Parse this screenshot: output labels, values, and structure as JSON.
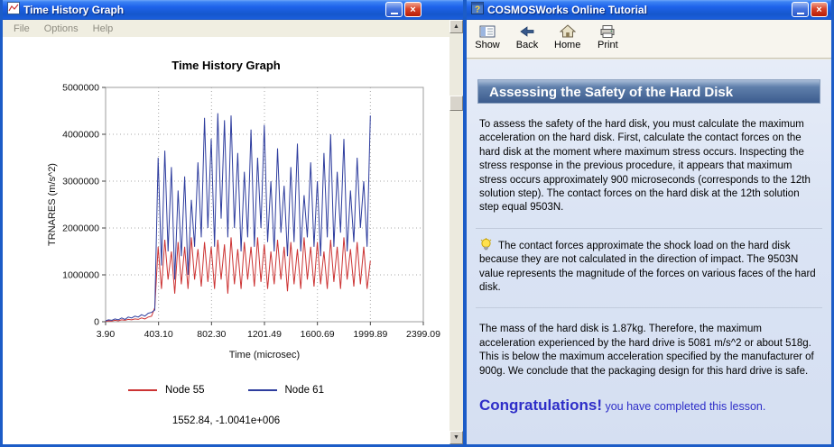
{
  "left_window": {
    "title": "Time History Graph",
    "menu": [
      "File",
      "Options",
      "Help"
    ],
    "chart_title": "Time History Graph",
    "status_readout": "1552.84, -1.0041e+006"
  },
  "chart_data": {
    "type": "line",
    "title": "Time History Graph",
    "xlabel": "Time (microsec)",
    "ylabel": "TRNARES (m/s^2)",
    "xlim": [
      3.9,
      2399.09
    ],
    "ylim": [
      0,
      5000000
    ],
    "x_tick_labels": [
      "3.90",
      "403.10",
      "802.30",
      "1201.49",
      "1600.69",
      "1999.89",
      "2399.09"
    ],
    "y_ticks": [
      0,
      1000000,
      2000000,
      3000000,
      4000000,
      5000000
    ],
    "grid": true,
    "legend_position": "bottom",
    "x": [
      3.9,
      25,
      50,
      75,
      100,
      125,
      150,
      175,
      200,
      225,
      250,
      275,
      300,
      325,
      350,
      375,
      400,
      425,
      450,
      475,
      500,
      525,
      550,
      575,
      600,
      625,
      650,
      675,
      700,
      725,
      750,
      775,
      800,
      825,
      850,
      875,
      900,
      925,
      950,
      975,
      1000,
      1025,
      1050,
      1075,
      1100,
      1125,
      1150,
      1175,
      1200,
      1225,
      1250,
      1275,
      1300,
      1325,
      1350,
      1375,
      1400,
      1425,
      1450,
      1475,
      1500,
      1525,
      1550,
      1575,
      1600,
      1625,
      1650,
      1675,
      1700,
      1725,
      1750,
      1775,
      1800,
      1825,
      1850,
      1875,
      1900,
      1925,
      1950,
      1975,
      2000
    ],
    "series": [
      {
        "name": "Node 55",
        "color": "#cc3333",
        "values": [
          10000.0,
          20000.0,
          15000.0,
          30000.0,
          20000.0,
          40000.0,
          30000.0,
          50000.0,
          40000.0,
          60000.0,
          50000.0,
          80000.0,
          60000.0,
          100000.0,
          120000.0,
          300000.0,
          1600000.0,
          700000.0,
          1750000.0,
          900000.0,
          1500000.0,
          600000.0,
          1700000.0,
          800000.0,
          1600000.0,
          700000.0,
          1800000.0,
          900000.0,
          1550000.0,
          750000.0,
          1700000.0,
          850000.0,
          1600000.0,
          700000.0,
          1750000.0,
          900000.0,
          1650000.0,
          600000.0,
          1800000.0,
          800000.0,
          1550000.0,
          700000.0,
          1700000.0,
          900000.0,
          1600000.0,
          750000.0,
          1800000.0,
          850000.0,
          1650000.0,
          700000.0,
          1500000.0,
          800000.0,
          1750000.0,
          900000.0,
          1600000.0,
          650000.0,
          1700000.0,
          800000.0,
          1550000.0,
          700000.0,
          1800000.0,
          900000.0,
          1600000.0,
          750000.0,
          1700000.0,
          800000.0,
          1500000.0,
          700000.0,
          1750000.0,
          850000.0,
          1600000.0,
          700000.0,
          1800000.0,
          900000.0,
          1550000.0,
          750000.0,
          1700000.0,
          800000.0,
          1600000.0,
          700000.0,
          1300000.0
        ]
      },
      {
        "name": "Node 61",
        "color": "#2e3d9e",
        "values": [
          20000.0,
          40000.0,
          30000.0,
          60000.0,
          40000.0,
          80000.0,
          50000.0,
          100000.0,
          80000.0,
          120000.0,
          100000.0,
          150000.0,
          120000.0,
          180000.0,
          200000.0,
          250000.0,
          3500000.0,
          1200000.0,
          3650000.0,
          1500000.0,
          3300000.0,
          900000.0,
          2800000.0,
          1400000.0,
          3100000.0,
          1000000.0,
          2600000.0,
          1600000.0,
          3400000.0,
          1800000.0,
          4350000.0,
          2000000.0,
          3900000.0,
          1600000.0,
          4450000.0,
          2200000.0,
          4300000.0,
          1800000.0,
          4400000.0,
          2000000.0,
          3600000.0,
          1500000.0,
          3200000.0,
          1800000.0,
          4100000.0,
          1600000.0,
          3500000.0,
          2000000.0,
          4200000.0,
          1700000.0,
          3000000.0,
          1500000.0,
          3700000.0,
          1900000.0,
          2900000.0,
          1400000.0,
          3300000.0,
          1700000.0,
          3800000.0,
          1500000.0,
          2700000.0,
          1800000.0,
          3400000.0,
          1600000.0,
          3000000.0,
          1400000.0,
          3600000.0,
          1800000.0,
          4000000.0,
          1600000.0,
          3200000.0,
          1900000.0,
          3900000.0,
          1500000.0,
          2800000.0,
          1700000.0,
          3500000.0,
          2000000.0,
          3000000.0,
          1600000.0,
          4400000.0
        ]
      }
    ]
  },
  "right_window": {
    "title": "COSMOSWorks Online Tutorial",
    "toolbar": {
      "items": [
        "Show",
        "Back",
        "Home",
        "Print"
      ]
    },
    "banner": "Assessing the Safety of the Hard Disk",
    "paragraphs": {
      "p1": "To assess the safety of the hard disk, you must calculate the maximum acceleration on the hard disk. First, calculate the contact forces on the hard disk at the moment where maximum stress occurs. Inspecting the stress response in the previous procedure, it appears that maximum stress occurs approximately 900 microseconds (corresponds to the 12th solution step). The contact forces on the hard disk at the 12th solution step equal 9503N.",
      "tip": "The contact forces approximate the shock load on the hard disk because they are not calculated in the direction of impact. The 9503N value represents the magnitude of the forces on various faces of the hard disk.",
      "p2": "The mass of the hard disk is 1.87kg. Therefore, the maximum acceleration experienced by the hard drive is 5081 m/s^2 or about 518g. This is below the maximum acceleration specified by the manufacturer of 900g. We conclude that the packaging design for this hard drive is safe."
    },
    "congratulations": {
      "bold": "Congratulations!",
      "rest": " you have completed this lesson."
    }
  },
  "colors": {
    "titlebar_blue": "#1e62ea",
    "node55_red": "#cc3333",
    "node61_blue": "#2e3d9e",
    "banner_blue": "#3c5c8e",
    "congrats_blue": "#2e2ec8"
  }
}
